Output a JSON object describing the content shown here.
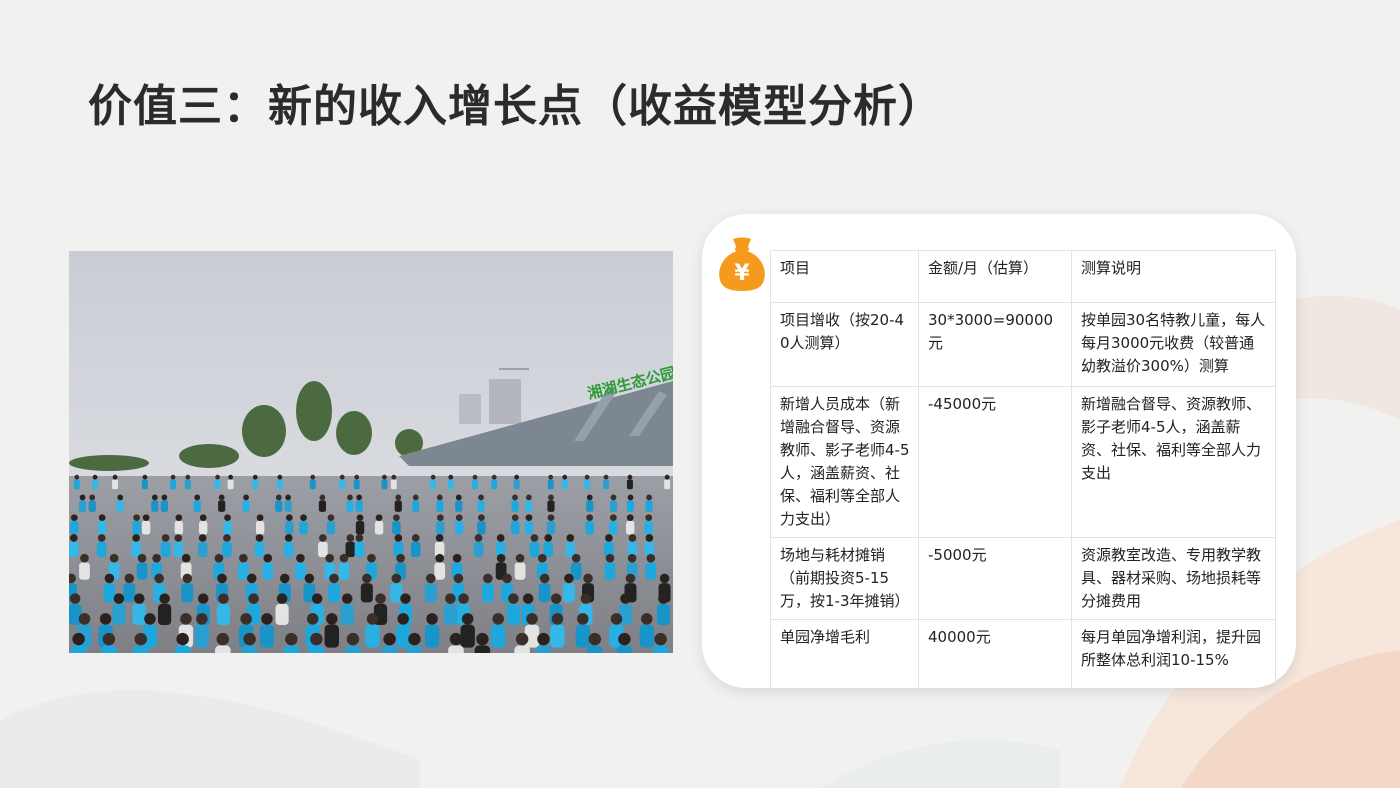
{
  "slide": {
    "title": "价值三：新的收入增长点（收益模型分析）"
  },
  "photo": {
    "banner_text": "湘湖生态公园"
  },
  "icon": {
    "name": "money-bag-icon",
    "symbol": "¥",
    "color": "#f59a1c"
  },
  "table": {
    "headers": [
      "项目",
      "金额/月（估算）",
      "测算说明"
    ],
    "rows": [
      {
        "item": "项目增收（按20-40人测算）",
        "amount": "30*3000=90000元",
        "note": "按单园30名特教儿童，每人每月3000元收费（较普通幼教溢价300%）测算"
      },
      {
        "item": "新增人员成本（新增融合督导、资源教师、影子老师4-5人，涵盖薪资、社保、福利等全部人力支出）",
        "amount": "-45000元",
        "note": "新增融合督导、资源教师、影子老师4-5人，涵盖薪资、社保、福利等全部人力支出"
      },
      {
        "item": "场地与耗材摊销（前期投资5-15万，按1-3年摊销）",
        "amount": "-5000元",
        "note": "资源教室改造、专用教学教具、器材采购、场地损耗等分摊费用"
      },
      {
        "item": "单园净增毛利",
        "amount": "40000元",
        "note": "每月单园净增利润，提升园所整体总利润10-15%"
      }
    ]
  }
}
